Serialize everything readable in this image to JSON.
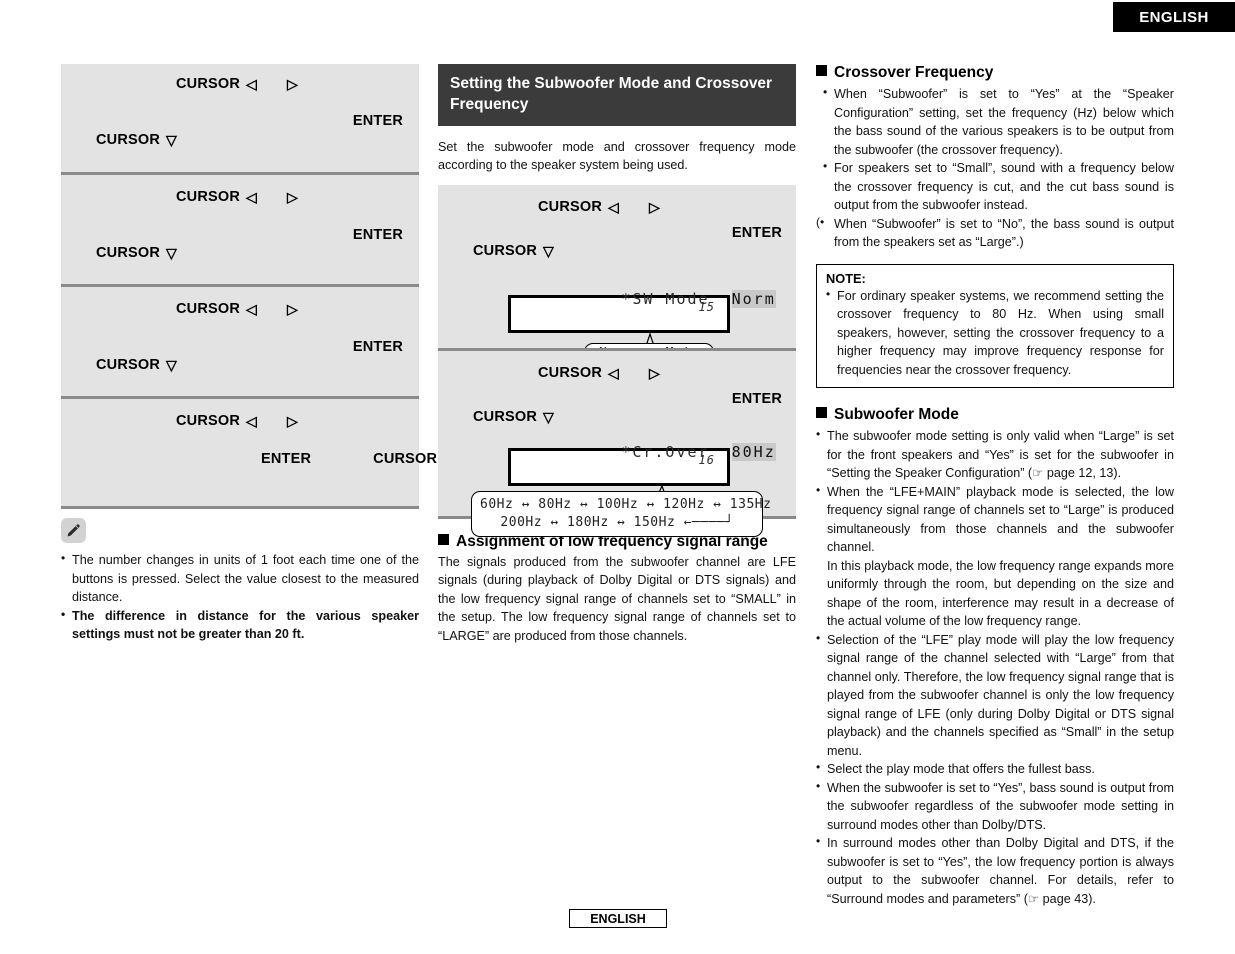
{
  "language_tab": {
    "top_label": "ENGLISH",
    "bottom_label": "ENGLISH"
  },
  "left_column": {
    "steps": [
      {
        "line1": "CURSOR",
        "tri_left": "◁",
        "tri_right": "▷",
        "enter": "ENTER",
        "line2": "CURSOR",
        "tri_down": "▽"
      },
      {
        "line1": "CURSOR",
        "tri_left": "◁",
        "tri_right": "▷",
        "enter": "ENTER",
        "line2": "CURSOR",
        "tri_down": "▽"
      },
      {
        "line1": "CURSOR",
        "tri_left": "◁",
        "tri_right": "▷",
        "enter": "ENTER",
        "line2": "CURSOR",
        "tri_down": "▽"
      },
      {
        "line1": "CURSOR",
        "tri_left": "◁",
        "tri_right": "▷",
        "enter": "ENTER",
        "line2": "CURSOR",
        "tri_down": "▽"
      }
    ],
    "note_icon": "pencil-icon",
    "notes": [
      "The number changes in units of 1 foot each time one of the buttons is pressed. Select the value closest to the measured distance.",
      "The difference in distance for the various speaker settings must not be greater than 20 ft."
    ]
  },
  "middle_column": {
    "section_title": "Setting the Subwoofer Mode and Crossover Frequency",
    "intro": "Set the subwoofer mode and crossover frequency mode according to the speaker system being used.",
    "steps": [
      {
        "line1": "CURSOR",
        "tri_left": "◁",
        "tri_right": "▷",
        "enter": "ENTER",
        "line2": "CURSOR",
        "tri_down": "▽",
        "lcd_number": "15",
        "lcd_label": "*SW Mode",
        "lcd_value": "Norm",
        "options_row1": "Norm ↔ +Main",
        "options_row2": ""
      },
      {
        "line1": "CURSOR",
        "tri_left": "◁",
        "tri_right": "▷",
        "enter": "ENTER",
        "line2": "CURSOR",
        "tri_down": "▽",
        "lcd_number": "16",
        "lcd_label": "*Cr.Over",
        "lcd_value": "80Hz",
        "options_row1": "60Hz ↔ 80Hz ↔ 100Hz ↔ 120Hz ↔ 135Hz",
        "options_row2": "200Hz ↔ 180Hz ↔ 150Hz ←────┘"
      }
    ],
    "assignment": {
      "heading": "Assignment of low frequency signal range",
      "text": "The signals produced from the subwoofer channel are LFE signals (during playback of Dolby Digital or DTS signals) and the low frequency signal range of channels set to “SMALL” in the setup. The low frequency signal range of channels set to “LARGE” are produced from those channels."
    }
  },
  "right_column": {
    "crossover": {
      "heading": "Crossover Frequency",
      "bullets": [
        "When “Subwoofer” is set to “Yes” at the “Speaker Configuration” setting, set the frequency (Hz) below which the bass sound of the various speakers is to be output from the subwoofer (the crossover frequency).",
        "For speakers set to “Small”, sound with a frequency below the crossover frequency is cut, and the cut bass sound is output from the subwoofer instead.",
        "When “Subwoofer” is set to “No”, the bass sound is output from the speakers set as “Large”.)"
      ]
    },
    "note": {
      "title": "NOTE:",
      "bullets": [
        "For ordinary speaker systems, we recommend setting the crossover frequency to 80 Hz. When using small speakers, however, setting the crossover frequency to a higher frequency may improve frequency response for frequencies near the crossover frequency."
      ]
    },
    "subwoofer_mode": {
      "heading": "Subwoofer Mode",
      "bullets": [
        "The subwoofer mode setting is only valid when “Large” is set for the front speakers and “Yes” is set for the subwoofer in “Setting the Speaker Configuration” (☞ page 12, 13).",
        "When the “LFE+MAIN” playback mode is selected, the low frequency signal range of channels set to “Large” is produced simultaneously from those channels and the subwoofer channel.",
        "In this playback mode, the low frequency range expands more uniformly through the room, but depending on the size and shape of the room, interference may result in a decrease of the actual volume of the low frequency range.",
        "Selection of the “LFE” play mode will play the low frequency signal range of the channel selected with “Large” from that channel only. Therefore, the low frequency signal range that is played from the subwoofer channel is only the low frequency signal range of LFE (only during Dolby Digital or DTS signal playback) and the channels specified as “Small” in the setup menu.",
        "Select the play mode that offers the fullest bass.",
        "When the subwoofer is set to “Yes”, bass sound is output from the subwoofer regardless of the subwoofer mode setting in surround modes other than Dolby/DTS.",
        "In surround modes other than Dolby Digital and DTS, if the subwoofer is set to “Yes”, the low frequency portion is always output to the subwoofer channel. For details, refer to “Surround modes and parameters” (☞ page 43)."
      ]
    }
  },
  "colors": {
    "panel_bg": "#e3e3e3",
    "panel_divider": "#8a8a8a",
    "section_header_bg": "#3b3b3b",
    "lcd_highlight": "#c9c9c9",
    "tab_bg": "#000000"
  }
}
